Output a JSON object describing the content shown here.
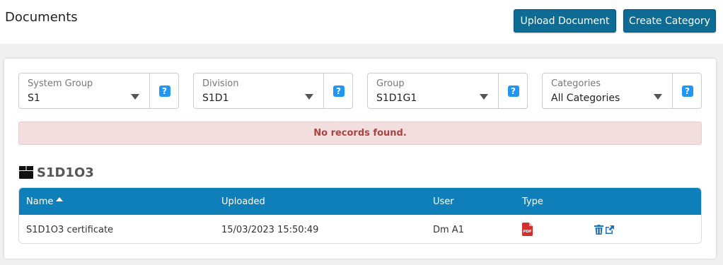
{
  "header": {
    "title": "Documents",
    "upload_label": "Upload Document",
    "create_label": "Create Category"
  },
  "filters": [
    {
      "label": "System Group",
      "value": "S1",
      "help": "?"
    },
    {
      "label": "Division",
      "value": "S1D1",
      "help": "?"
    },
    {
      "label": "Group",
      "value": "S1D1G1",
      "help": "?"
    },
    {
      "label": "Categories",
      "value": "All Categories",
      "help": "?"
    }
  ],
  "alert": {
    "message": "No records found."
  },
  "section": {
    "title": "S1D1O3",
    "icon": "box-icon"
  },
  "table": {
    "columns": {
      "name": "Name",
      "uploaded": "Uploaded",
      "user": "User",
      "type": "Type"
    },
    "rows": [
      {
        "name": "S1D1O3 certificate",
        "uploaded": "15/03/2023 15:50:49",
        "user": "Dm A1",
        "type_icon": "pdf-icon",
        "pdf_text": "PDF"
      }
    ]
  },
  "colors": {
    "button": "#0e6c94",
    "table_header": "#0e7fb8",
    "help": "#2196f3",
    "alert_bg": "#f2dede",
    "alert_text": "#a94442",
    "pdf": "#d32f2f",
    "action": "#1e73be"
  }
}
